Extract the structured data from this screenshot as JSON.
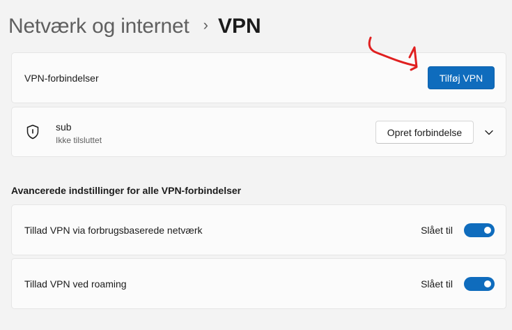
{
  "breadcrumb": {
    "parent": "Netværk og internet",
    "separator": "›",
    "current": "VPN"
  },
  "vpn_connections": {
    "label": "VPN-forbindelser",
    "add_button_label": "Tilføj VPN"
  },
  "connection": {
    "name": "sub",
    "status": "Ikke tilsluttet",
    "connect_button_label": "Opret forbindelse"
  },
  "advanced": {
    "header": "Avancerede indstillinger for alle VPN-forbindelser",
    "settings": [
      {
        "label": "Tillad VPN via forbrugsbaserede netværk",
        "state_label": "Slået til",
        "enabled": true
      },
      {
        "label": "Tillad VPN ved roaming",
        "state_label": "Slået til",
        "enabled": true
      }
    ]
  },
  "colors": {
    "accent": "#0f6cbd",
    "annotation": "#e02020"
  },
  "icons": {
    "connection": "shield-icon",
    "expand": "chevron-down-icon"
  }
}
